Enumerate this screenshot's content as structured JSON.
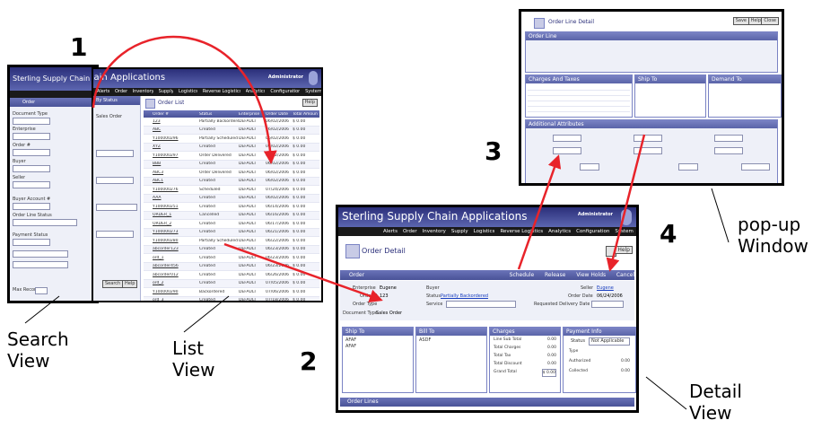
{
  "callouts": {
    "n1": "1",
    "n2": "2",
    "n3": "3",
    "n4": "4",
    "search_view": [
      "Search",
      "View"
    ],
    "list_view": [
      "List",
      "View"
    ],
    "detail_view": [
      "Detail",
      "View"
    ],
    "popup_window": [
      "pop-up",
      "Window"
    ]
  },
  "app": {
    "title": "Sterling Supply Chain Applications",
    "user": "Administrator",
    "menu": [
      "Alerts",
      "Order",
      "Inventory",
      "Supply",
      "Logistics",
      "Reverse Logistics",
      "Analytics",
      "Configuration",
      "System"
    ],
    "help": "Help"
  },
  "search_panel": {
    "cols": [
      "Order",
      "By Status"
    ],
    "labels": [
      "Document Type",
      "Enterprise",
      "Order #",
      "Buyer",
      "Seller",
      "Buyer Account #",
      "Order Line Status",
      "Payment Status"
    ],
    "doc_type_value": "Sales Order",
    "max_records_label": "Max Records",
    "max_records_value": "30",
    "search_btn": "Search",
    "help_btn": "Help"
  },
  "list_panel": {
    "header": "Order List",
    "headers": [
      "Order #",
      "Status",
      "Enterprise",
      "Order Date",
      "Total Amount"
    ],
    "rows": [
      [
        "123",
        "Partially Backordered",
        "DEFAULT",
        "06/02/2006",
        "$ 0.00"
      ],
      [
        "ABC",
        "Created",
        "DEFAULT",
        "06/02/2006",
        "$ 0.00"
      ],
      [
        "Y100000296",
        "Partially Scheduled",
        "DEFAULT",
        "06/02/2006",
        "$ 0.00"
      ],
      [
        "XYZ",
        "Created",
        "DEFAULT",
        "06/02/2006",
        "$ 0.00"
      ],
      [
        "Y100000297",
        "Order Delivered",
        "DEFAULT",
        "06/02/2006",
        "$ 0.00"
      ],
      [
        "BBB",
        "Created",
        "DEFAULT",
        "06/02/2006",
        "$ 0.00"
      ],
      [
        "ABC3",
        "Order Delivered",
        "DEFAULT",
        "06/02/2006",
        "$ 0.00"
      ],
      [
        "ABC1",
        "Created",
        "DEFAULT",
        "06/02/2006",
        "$ 0.00"
      ],
      [
        "Y100000276",
        "Scheduled",
        "DEFAULT",
        "07/24/2006",
        "$ 0.00"
      ],
      [
        "AAA",
        "Created",
        "DEFAULT",
        "06/02/2006",
        "$ 0.00"
      ],
      [
        "Y100000251",
        "Created",
        "DEFAULT",
        "06/14/2006",
        "$ 0.00"
      ],
      [
        "ORDER_1",
        "Cancelled",
        "DEFAULT",
        "06/16/2006",
        "$ 0.00"
      ],
      [
        "ORDER_2",
        "Created",
        "DEFAULT",
        "06/17/2006",
        "$ 0.00"
      ],
      [
        "Y100000273",
        "Created",
        "DEFAULT",
        "06/21/2006",
        "$ 0.00"
      ],
      [
        "Y100000280",
        "Partially Scheduled",
        "DEFAULT",
        "06/22/2006",
        "$ 0.00"
      ],
      [
        "abcorder123",
        "Created",
        "DEFAULT",
        "06/23/2006",
        "$ 0.00"
      ],
      [
        "ord_1",
        "Created",
        "DEFAULT",
        "06/23/2006",
        "$ 0.00"
      ],
      [
        "abcorder456",
        "Created",
        "DEFAULT",
        "06/23/2006",
        "$ 0.00"
      ],
      [
        "abcorder012",
        "Created",
        "DEFAULT",
        "06/26/2006",
        "$ 0.00"
      ],
      [
        "ord_2",
        "Created",
        "DEFAULT",
        "07/05/2006",
        "$ 0.00"
      ],
      [
        "Y100000290",
        "Backordered",
        "DEFAULT",
        "07/06/2006",
        "$ 0.00"
      ],
      [
        "ord_3",
        "Created",
        "DEFAULT",
        "07/18/2006",
        "$ 0.00"
      ],
      [
        "abc_1",
        "Shipped",
        "DEFAULT",
        "07/18/2006",
        "$ 0.00"
      ],
      [
        "Y100000299",
        "Backordered",
        "DEFAULT",
        "07/18/2006",
        "$ 0.00"
      ],
      [
        "ord_4",
        "Created",
        "DEFAULT",
        "07/20/2006",
        "$ 0.00"
      ],
      [
        "ORDER_3",
        "Created",
        "DEFAULT",
        "07/24/2006",
        "$ 0.00"
      ],
      [
        "ORDER_4",
        "Cancelled",
        "DEFAULT",
        "07/25/2006",
        "$ 0.00"
      ]
    ]
  },
  "detail": {
    "page_title": "Order Detail",
    "toolbar_label": "Order",
    "actions": [
      "Schedule",
      "Release",
      "View Holds",
      "Cancel"
    ],
    "buyer_label": "Buyer",
    "status_label": "Status",
    "status_value": "Partially Backordered",
    "enterprise_label": "Enterprise",
    "enterprise_value": "Eugene",
    "order_no_label": "Order #",
    "order_no_value": "123",
    "order_type_label": "Order Type",
    "service_label": "Service",
    "doc_type_label": "Document Type",
    "doc_type_value": "Sales Order",
    "seller_label": "Seller",
    "seller_value": "Eugene",
    "order_date_label": "Order Date",
    "order_date_value": "06/24/2006",
    "req_delivery_label": "Requested Delivery Date",
    "ship_to": "Ship To",
    "bill_to": "Bill To",
    "charges": "Charges",
    "payment": "Payment Info",
    "ship_addr": [
      "AFAF",
      "AFAF"
    ],
    "bill_addr": [
      "ASDF"
    ],
    "charge_labels": [
      "Line Sub Total",
      "Total Charges",
      "Total Tax",
      "Total Discount",
      "Grand Total"
    ],
    "charge_values": [
      "0.00",
      "0.00",
      "0.00",
      "0.00",
      "$ 0.00"
    ],
    "pay_status_label": "Status",
    "pay_status_value": "Not Applicable",
    "pay_labels": [
      "Type",
      "Authorized",
      "Collected"
    ],
    "pay_values": [
      "",
      "0.00",
      "0.00"
    ],
    "order_lines": "Order Lines"
  },
  "popup": {
    "title": "Order Line Detail",
    "buttons": [
      "Save",
      "Help",
      "Close"
    ],
    "section1": "Order Line",
    "charges_section": "Charges And Taxes",
    "ship_to": "Ship To",
    "demand_to": "Demand To",
    "additional": "Additional Attributes"
  },
  "colors": {
    "arrow": "#e8232a",
    "accent": "#5a64a8"
  }
}
